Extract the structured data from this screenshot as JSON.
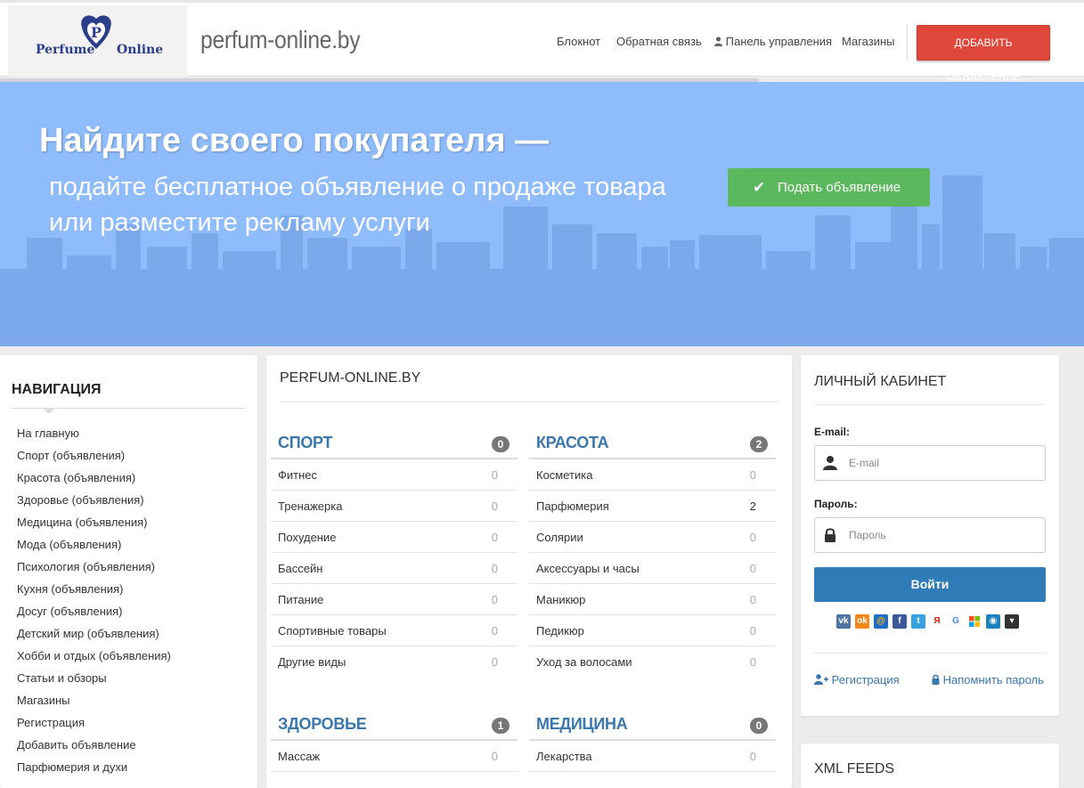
{
  "header": {
    "logo_left": "Perfume",
    "logo_right": "Online",
    "logo_letter": "P",
    "site_name": "perfum-online.by",
    "nav": [
      {
        "label": "Блокнот"
      },
      {
        "label": "Обратная связь"
      },
      {
        "label": "Панель управления",
        "icon": "user-icon"
      },
      {
        "label": "Магазины"
      }
    ],
    "add_button": "Добавить объявление"
  },
  "hero": {
    "title": "Найдите своего покупателя —",
    "subtitle_line1": "подайте бесплатное объявление о продаже товара",
    "subtitle_line2": "или разместите рекламу услуги",
    "button": "Подать объявление",
    "button_icon": "check-icon",
    "bg_color": "#8ebcfd"
  },
  "navigation": {
    "title": "НАВИГАЦИЯ",
    "items": [
      "На главную",
      "Спорт (объявления)",
      "Красота (объявления)",
      "Здоровье (объявления)",
      "Медицина (объявления)",
      "Мода (объявления)",
      "Психология (объявления)",
      "Кухня (объявления)",
      "Досуг (объявления)",
      "Детский мир (объявления)",
      "Хобби и отдых (объявления)",
      "Статьи и обзоры",
      "Магазины",
      "Регистрация",
      "Добавить объявление",
      "Парфюмерия и духи"
    ]
  },
  "main": {
    "title": "PERFUM-ONLINE.BY",
    "categories": [
      {
        "name": "СПОРТ",
        "count": "0",
        "items": [
          {
            "label": "Фитнес",
            "count": "0"
          },
          {
            "label": "Тренажерка",
            "count": "0"
          },
          {
            "label": "Похудение",
            "count": "0"
          },
          {
            "label": "Бассейн",
            "count": "0"
          },
          {
            "label": "Питание",
            "count": "0"
          },
          {
            "label": "Спортивные товары",
            "count": "0"
          },
          {
            "label": "Другие виды",
            "count": "0"
          }
        ]
      },
      {
        "name": "КРАСОТА",
        "count": "2",
        "items": [
          {
            "label": "Косметика",
            "count": "0"
          },
          {
            "label": "Парфюмерия",
            "count": "2"
          },
          {
            "label": "Солярии",
            "count": "0"
          },
          {
            "label": "Аксессуары и часы",
            "count": "0"
          },
          {
            "label": "Маникюр",
            "count": "0"
          },
          {
            "label": "Педикюр",
            "count": "0"
          },
          {
            "label": "Уход за волосами",
            "count": "0"
          }
        ]
      },
      {
        "name": "ЗДОРОВЬЕ",
        "count": "1",
        "items": [
          {
            "label": "Массаж",
            "count": "0"
          }
        ]
      },
      {
        "name": "МЕДИЦИНА",
        "count": "0",
        "items": [
          {
            "label": "Лекарства",
            "count": "0"
          }
        ]
      }
    ]
  },
  "account": {
    "title": "ЛИЧНЫЙ КАБИНЕТ",
    "email_label": "E-mail:",
    "email_placeholder": "E-mail",
    "password_label": "Пароль:",
    "password_placeholder": "Пароль",
    "login_button": "Войти",
    "socials": [
      {
        "name": "vk-icon",
        "glyph": "vk",
        "color": "#4c75a3"
      },
      {
        "name": "odnoklassniki-icon",
        "glyph": "ok",
        "color": "#f2861d"
      },
      {
        "name": "mailru-icon",
        "glyph": "@",
        "color": "#1d6ecb"
      },
      {
        "name": "facebook-icon",
        "glyph": "f",
        "color": "#3b5998"
      },
      {
        "name": "twitter-icon",
        "glyph": "t",
        "color": "#36a2e0"
      },
      {
        "name": "yandex-icon",
        "glyph": "Я",
        "color": "#ffffff"
      },
      {
        "name": "google-icon",
        "glyph": "G",
        "color": "#ffffff"
      },
      {
        "name": "windows-icon",
        "glyph": "⊞",
        "color": "#ffffff"
      },
      {
        "name": "steam-icon",
        "glyph": "◉",
        "color": "#1a82bd"
      },
      {
        "name": "more-icon",
        "glyph": "▾",
        "color": "#333333"
      }
    ],
    "register_link": "Регистрация",
    "register_icon": "user-plus-icon",
    "remind_link": "Напомнить пароль",
    "remind_icon": "lock-icon"
  },
  "xml": {
    "title": "XML FEEDS"
  },
  "colors": {
    "accent_red": "#e0473b",
    "accent_green": "#5cb85c",
    "accent_blue": "#2f7bb8",
    "category_blue": "#3a77ad"
  }
}
